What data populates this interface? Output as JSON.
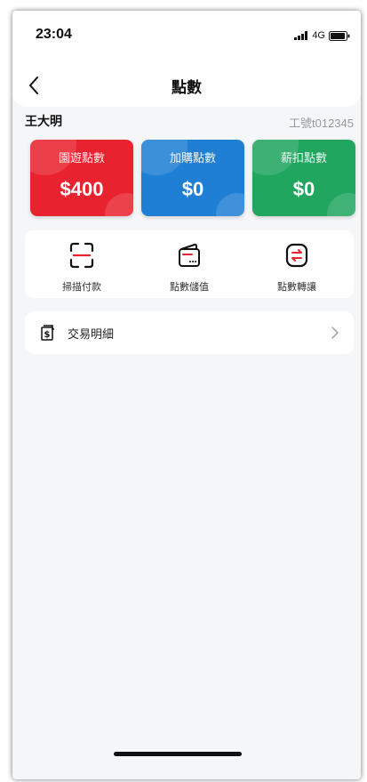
{
  "status_bar": {
    "time": "23:04",
    "network": "4G",
    "icons": [
      "signal-icon",
      "battery-icon"
    ]
  },
  "header": {
    "title": "點數",
    "back_icon": "chevron-left-icon"
  },
  "user": {
    "name": "王大明",
    "employee_no": "工號t012345"
  },
  "cards": [
    {
      "label": "園遊點數",
      "value": "$400",
      "color": "#e8232f"
    },
    {
      "label": "加購點數",
      "value": "$0",
      "color": "#1f7fd4"
    },
    {
      "label": "薪扣點數",
      "value": "$0",
      "color": "#21a660"
    }
  ],
  "actions": [
    {
      "label": "掃描付款",
      "icon": "scan-icon"
    },
    {
      "label": "點數儲值",
      "icon": "wallet-icon"
    },
    {
      "label": "點數轉讓",
      "icon": "transfer-icon"
    }
  ],
  "transactions": {
    "label": "交易明細",
    "icon": "receipt-dollar-icon",
    "chevron_icon": "chevron-right-icon"
  },
  "colors": {
    "accent_red": "#e8232f",
    "accent_blue": "#1f7fd4",
    "accent_green": "#21a660",
    "background": "#f5f6f8"
  }
}
